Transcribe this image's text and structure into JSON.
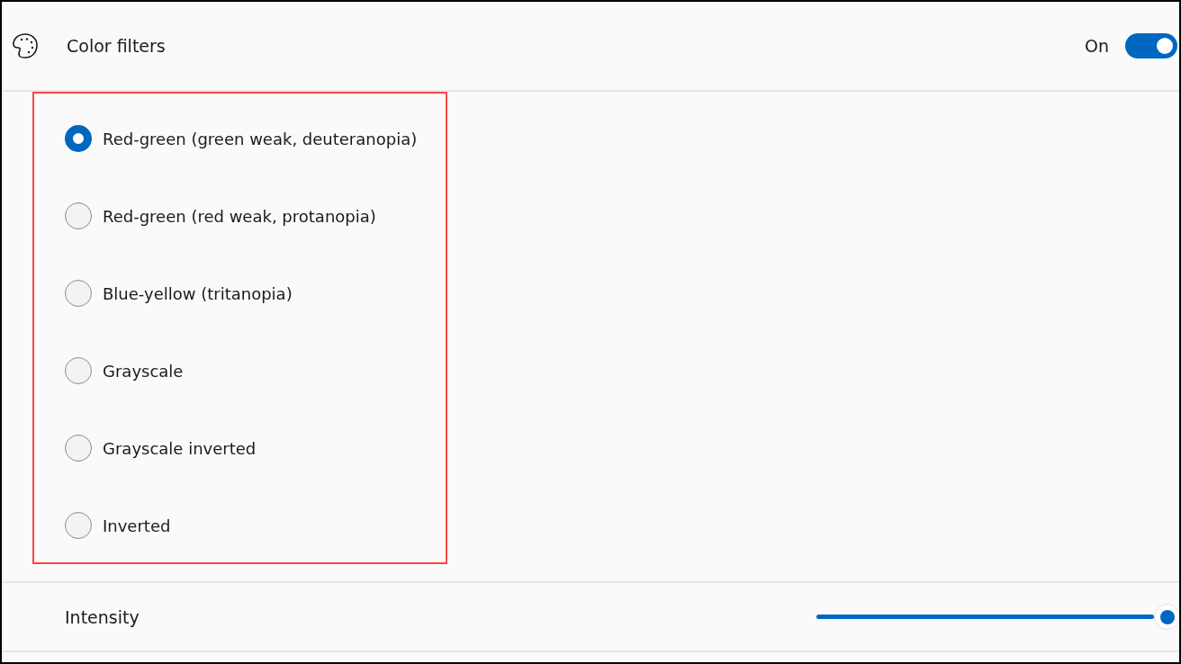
{
  "header": {
    "title": "Color filters",
    "toggle_label": "On",
    "on": true
  },
  "options": [
    {
      "label": "Red-green (green weak, deuteranopia)",
      "selected": true
    },
    {
      "label": "Red-green (red weak, protanopia)",
      "selected": false
    },
    {
      "label": "Blue-yellow (tritanopia)",
      "selected": false
    },
    {
      "label": "Grayscale",
      "selected": false
    },
    {
      "label": "Grayscale inverted",
      "selected": false
    },
    {
      "label": "Inverted",
      "selected": false
    }
  ],
  "intensity": {
    "label": "Intensity",
    "level": 1
  }
}
